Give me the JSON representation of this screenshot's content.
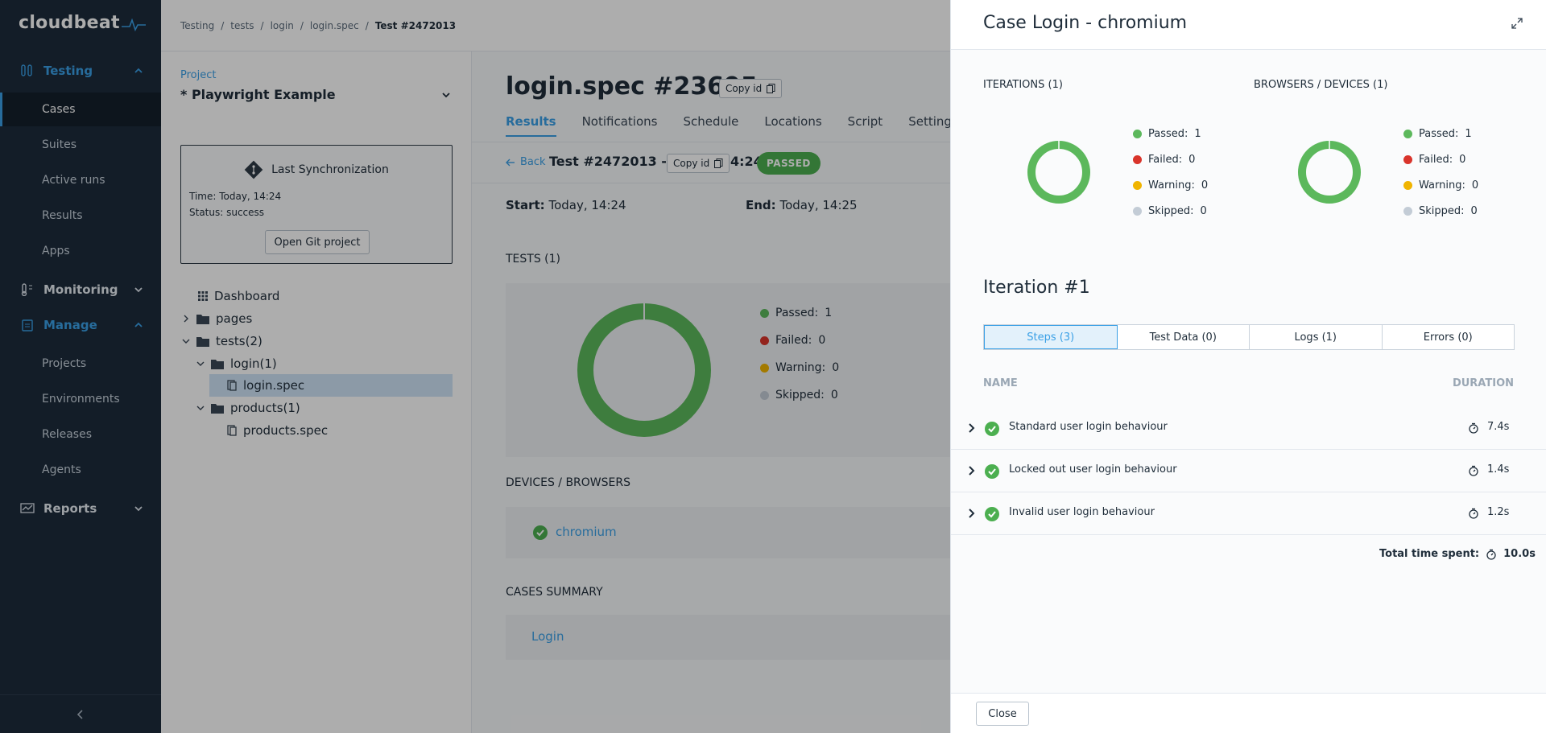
{
  "app": {
    "logo_text": "cloudbeat"
  },
  "sidebar": {
    "groups": [
      {
        "label": "Testing",
        "icon": "flask-icon"
      },
      {
        "label": "Monitoring",
        "icon": "thermometer-icon"
      },
      {
        "label": "Manage",
        "icon": "clipboard-icon"
      },
      {
        "label": "Reports",
        "icon": "chart-icon"
      }
    ],
    "testing_items": [
      "Cases",
      "Suites",
      "Active runs",
      "Results",
      "Apps"
    ],
    "manage_items": [
      "Projects",
      "Environments",
      "Releases",
      "Agents"
    ]
  },
  "breadcrumb": [
    "Testing",
    "tests",
    "login",
    "login.spec",
    "Test #2472013"
  ],
  "project": {
    "label": "Project",
    "name": "* Playwright Example"
  },
  "sync": {
    "title": "Last Synchronization",
    "time": "Time: Today, 14:24",
    "status": "Status: success",
    "button": "Open Git project"
  },
  "tree": {
    "dashboard": "Dashboard",
    "pages": "pages",
    "tests": "tests(2)",
    "login": "login(1)",
    "login_spec": "login.spec",
    "products": "products(1)",
    "products_spec": "products.spec"
  },
  "spec": {
    "title": "login.spec #23695",
    "copy_id": "Copy id",
    "tabs": [
      "Results",
      "Notifications",
      "Schedule",
      "Locations",
      "Script",
      "Settings"
    ],
    "back": "Back",
    "run_title": "Test #2472013 - Today, 14:24",
    "status": "PASSED",
    "start_label": "Start:",
    "start_value": "Today, 14:24",
    "end_label": "End:",
    "end_value": "Today, 14:25",
    "tests_title": "TESTS (1)",
    "devices_title": "DEVICES / BROWSERS",
    "device_name": "chromium",
    "cases_title": "CASES SUMMARY",
    "case_name": "Login",
    "legend": {
      "passed": "Passed:",
      "failed": "Failed:",
      "warning": "Warning:",
      "skipped": "Skipped:"
    },
    "counts": {
      "passed": "1",
      "failed": "0",
      "warning": "0",
      "skipped": "0"
    }
  },
  "drawer": {
    "title": "Case Login - chromium",
    "iterations_title": "ITERATIONS (1)",
    "browsers_title": "BROWSERS / DEVICES (1)",
    "legend": {
      "passed": "Passed:",
      "failed": "Failed:",
      "warning": "Warning:",
      "skipped": "Skipped:"
    },
    "counts": {
      "passed": "1",
      "failed": "0",
      "warning": "0",
      "skipped": "0"
    },
    "iteration_title": "Iteration #1",
    "segments": [
      "Steps (3)",
      "Test Data (0)",
      "Logs (1)",
      "Errors (0)"
    ],
    "col_name": "NAME",
    "col_duration": "DURATION",
    "steps": [
      {
        "name": "Standard user login behaviour",
        "duration": "7.4s"
      },
      {
        "name": "Locked out user login behaviour",
        "duration": "1.4s"
      },
      {
        "name": "Invalid user login behaviour",
        "duration": "1.2s"
      }
    ],
    "total_label": "Total time spent:",
    "total_value": "10.0s",
    "close": "Close"
  },
  "colors": {
    "accent": "#3aa0e6",
    "passed": "#5cb85c",
    "failed": "#d9342b",
    "warning": "#f0b400",
    "skipped": "#c3ccd6",
    "sidebar_bg": "#1c2b3b"
  }
}
